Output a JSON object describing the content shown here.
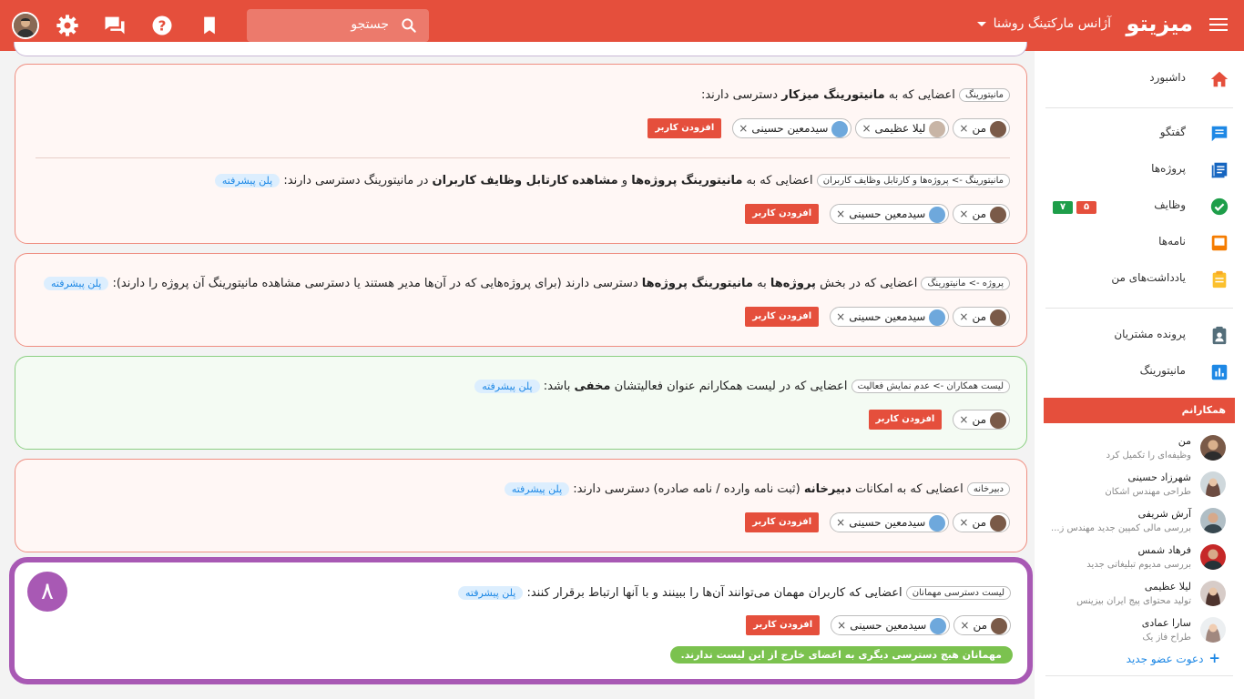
{
  "topbar": {
    "logo": "میزیتو",
    "org_name": "آژانس مارکتینگ روشنا",
    "search_placeholder": "جستجو",
    "colors": {
      "bar": "#e54f3c"
    }
  },
  "sidebar": {
    "dashboard": "داشبورد",
    "chat": "گفتگو",
    "projects": "پروژه‌ها",
    "tasks": "وظایف",
    "tasks_badge_green": "۷",
    "tasks_badge_red": "۵",
    "letters": "نامه‌ها",
    "notes": "یادداشت‌های من",
    "customers": "پرونده مشتریان",
    "monitoring": "مانیتورینگ",
    "team_header": "همکارانم",
    "members": [
      {
        "name": "من",
        "sub": "وظیفه‌ای را تکمیل کرد"
      },
      {
        "name": "شهرزاد حسینی",
        "sub": "طراحی مهندس اشکان"
      },
      {
        "name": "آرش شریفی",
        "sub": "بررسی مالی کمپین جدید مهندس ز..."
      },
      {
        "name": "فرهاد شمس",
        "sub": "بررسی مدیوم تبلیغاتی جدید"
      },
      {
        "name": "لیلا عظیمی",
        "sub": "تولید محتوای پیج ایران بیزینس"
      },
      {
        "name": "سارا عمادی",
        "sub": "طراح فاز یک"
      }
    ],
    "invite": "دعوت عضو جدید"
  },
  "main": {
    "common": {
      "me": "من",
      "seyed": "سیدمعین حسینی",
      "leila": "لیلا عظیمی",
      "add_user": "افزودن کاربر",
      "plan": "پلن پیشرفته",
      "close": "×"
    },
    "card1": {
      "tag": "مانیتورینگ",
      "text_a": "اعضایی که به",
      "bold_a": "مانیتورینگ میزکار",
      "text_b": "دسترسی دارند:"
    },
    "card1b": {
      "tag": "مانیتورینگ -> پروژه‌ها و کارتابل وظایف کاربران",
      "text_a": "اعضایی که به",
      "bold_a": "مانیتورینگ پروژه‌ها",
      "text_b": "و",
      "bold_b": "مشاهده کارتابل وظایف کاربران",
      "text_c": "در مانیتورینگ دسترسی دارند:"
    },
    "card2": {
      "tag": "پروژه -> مانیتورینگ",
      "text_a": "اعضایی که در بخش",
      "bold_a": "پروژه‌ها",
      "text_b": "به",
      "bold_b": "مانیتورینگ پروژه‌ها",
      "text_c": "دسترسی دارند (برای پروژه‌هایی که در آن‌ها مدیر هستند یا دسترسی مشاهده مانیتورینگ آن پروژه را دارند):"
    },
    "card3": {
      "tag": "لیست همکاران -> عدم نمایش فعالیت",
      "text_a": "اعضایی که در لیست همکارانم عنوان فعالیتشان",
      "bold_a": "مخفی",
      "text_b": "باشد:"
    },
    "card4": {
      "tag": "دبیرخانه",
      "text_a": "اعضایی که به امکانات",
      "bold_a": "دبیرخانه",
      "text_b": "(ثبت نامه وارده / نامه صادره) دسترسی دارند:"
    },
    "card5": {
      "step": "۸",
      "tag": "لیست دسترسی مهمانان",
      "text_a": "اعضایی که کاربران مهمان می‌توانند آن‌ها را ببینند و با آنها ارتباط برقرار کنند:",
      "note": "مهمانان هیچ دسترسی دیگری به اعضای خارج از این لیست ندارند."
    }
  }
}
